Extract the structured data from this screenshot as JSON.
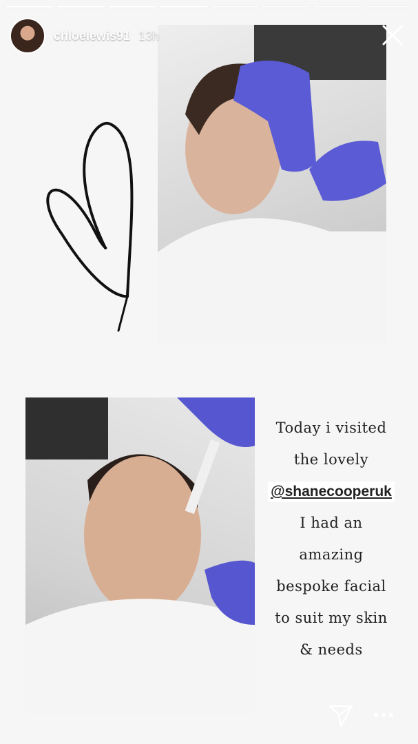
{
  "story": {
    "segments_total": 8,
    "segments_done": 4,
    "username": "chloelewis91",
    "time_ago": "13h"
  },
  "caption": {
    "line1": "Today i visited",
    "line2": "the lovely",
    "mention": "@shanecooperuk",
    "line3": "I had an",
    "line4": "amazing",
    "line5": "bespoke facial",
    "line6": "to suit my skin",
    "line7": "& needs"
  },
  "icons": {
    "close": "close-icon",
    "send": "send-icon",
    "more": "more-icon",
    "heart": "heart-doodle-icon"
  }
}
